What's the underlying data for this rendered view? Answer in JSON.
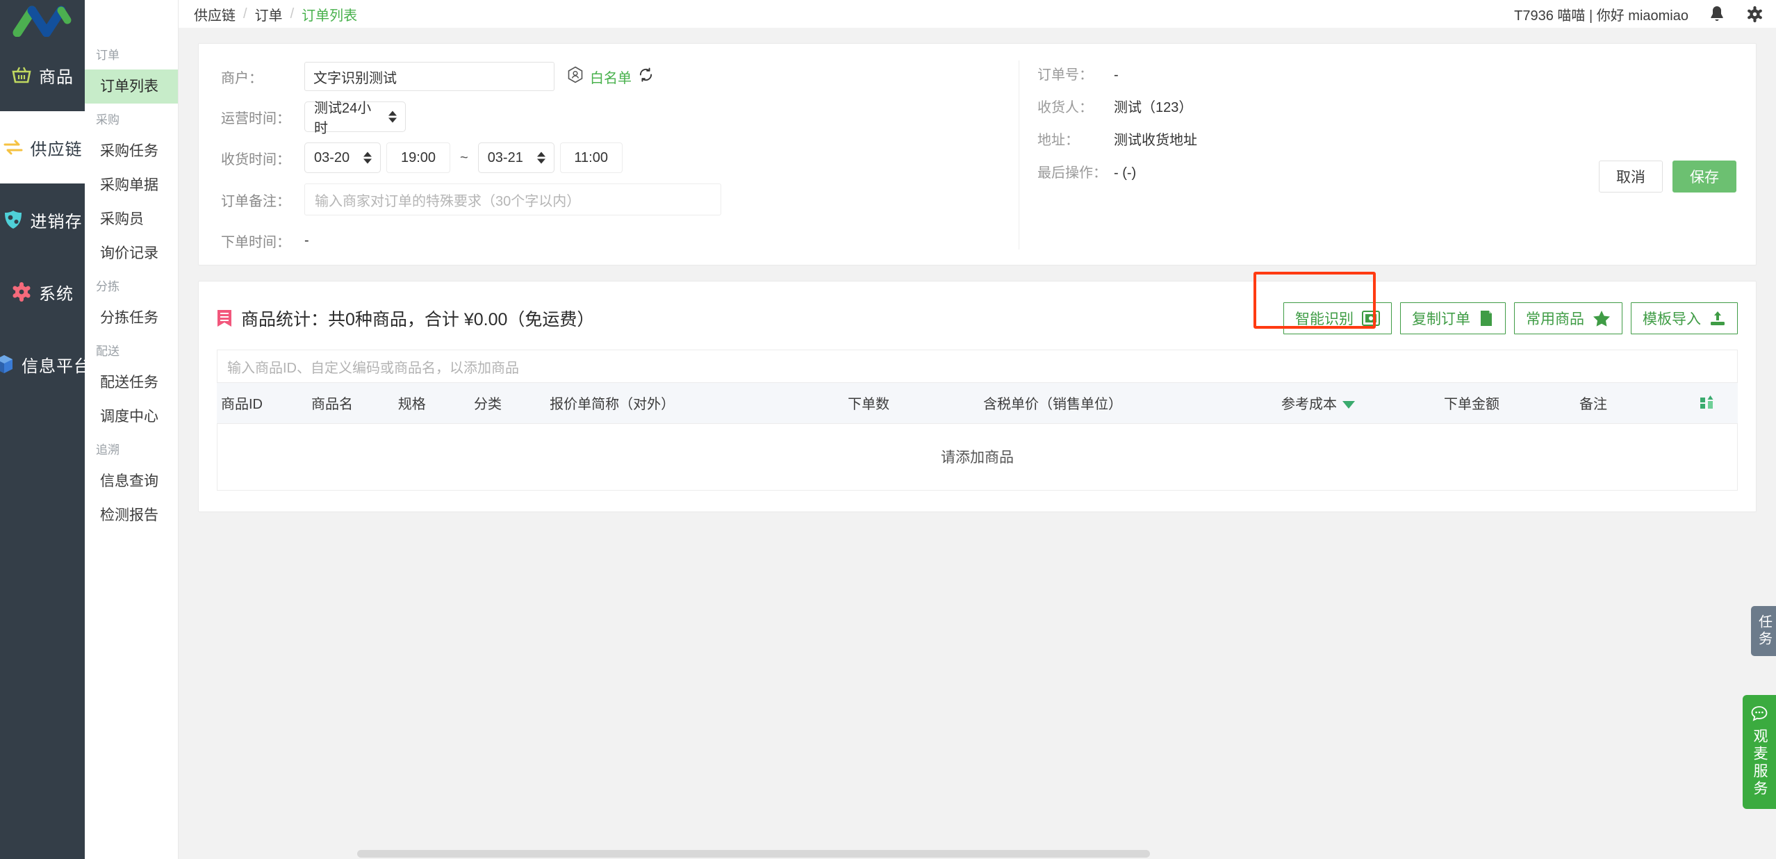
{
  "rail": {
    "logo_name": "app-logo",
    "items": [
      {
        "label": "商品",
        "icon": "basket-icon",
        "active": false
      },
      {
        "label": "供应链",
        "icon": "exchange-arrows-icon",
        "active": true
      },
      {
        "label": "进销存",
        "icon": "shield-inventory-icon",
        "active": false
      },
      {
        "label": "系统",
        "icon": "gear-icon",
        "active": false
      },
      {
        "label": "信息平台",
        "icon": "cube-icon",
        "active": false
      }
    ]
  },
  "submenu": {
    "groups": [
      {
        "title": "订单",
        "items": [
          {
            "label": "订单列表",
            "active": true
          }
        ]
      },
      {
        "title": "采购",
        "items": [
          {
            "label": "采购任务",
            "active": false
          },
          {
            "label": "采购单据",
            "active": false
          },
          {
            "label": "采购员",
            "active": false
          },
          {
            "label": "询价记录",
            "active": false
          }
        ]
      },
      {
        "title": "分拣",
        "items": [
          {
            "label": "分拣任务",
            "active": false
          }
        ]
      },
      {
        "title": "配送",
        "items": [
          {
            "label": "配送任务",
            "active": false
          },
          {
            "label": "调度中心",
            "active": false
          }
        ]
      },
      {
        "title": "追溯",
        "items": [
          {
            "label": "信息查询",
            "active": false
          },
          {
            "label": "检测报告",
            "active": false
          }
        ]
      }
    ]
  },
  "topbar": {
    "breadcrumb": [
      "供应链",
      "订单",
      "订单列表"
    ],
    "separator": "/",
    "user_text": "T7936 喵喵 | 你好 miaomiao",
    "bell_icon": "bell-icon",
    "gear_icon": "gear-icon"
  },
  "form": {
    "merchant_label": "商户：",
    "merchant_value": "文字识别测试",
    "whitelist_label": "白名单",
    "whitelist_icon": "user-hexagon-icon",
    "refresh_icon": "refresh-icon",
    "operating_label": "运营时间：",
    "operating_value": "测试24小时",
    "receive_label": "收货时间：",
    "receive_date_start": "03-20",
    "receive_time_start": "19:00",
    "range_sep": "~",
    "receive_date_end": "03-21",
    "receive_time_end": "11:00",
    "notes_label": "订单备注：",
    "notes_placeholder": "输入商家对订单的特殊要求（30个字以内）",
    "notes_value": "",
    "order_time_label": "下单时间：",
    "order_time_value": "-"
  },
  "info": {
    "rows": [
      {
        "label": "订单号：",
        "value": "-"
      },
      {
        "label": "收货人：",
        "value": "测试（123）"
      },
      {
        "label": "地址：",
        "value": "测试收货地址"
      },
      {
        "label": "最后操作：",
        "value": "- (-)"
      }
    ],
    "cancel_label": "取消",
    "save_label": "保存"
  },
  "products": {
    "summary": "商品统计：共0种商品，合计 ¥0.00（免运费）",
    "summary_icon": "ribbon-icon",
    "actions": [
      {
        "label": "智能识别",
        "icon": "ocr-scan-icon",
        "highlighted": true
      },
      {
        "label": "复制订单",
        "icon": "copy-icon",
        "highlighted": false
      },
      {
        "label": "常用商品",
        "icon": "star-icon",
        "highlighted": false
      },
      {
        "label": "模板导入",
        "icon": "upload-icon",
        "highlighted": false
      }
    ],
    "add_placeholder": "输入商品ID、自定义编码或商品名，以添加商品",
    "columns": [
      {
        "label": "商品ID",
        "align": "left",
        "sort": false,
        "icon": ""
      },
      {
        "label": "商品名",
        "align": "left",
        "sort": false,
        "icon": ""
      },
      {
        "label": "规格",
        "align": "left",
        "sort": false,
        "icon": ""
      },
      {
        "label": "分类",
        "align": "left",
        "sort": false,
        "icon": ""
      },
      {
        "label": "报价单简称（对外）",
        "align": "left",
        "sort": false,
        "icon": ""
      },
      {
        "label": "下单数",
        "align": "left",
        "sort": false,
        "icon": ""
      },
      {
        "label": "含税单价（销售单位）",
        "align": "left",
        "sort": false,
        "icon": ""
      },
      {
        "label": "参考成本",
        "align": "left",
        "sort": true,
        "icon": ""
      },
      {
        "label": "下单金额",
        "align": "left",
        "sort": false,
        "icon": ""
      },
      {
        "label": "备注",
        "align": "left",
        "sort": false,
        "icon": ""
      },
      {
        "label": "",
        "align": "center",
        "sort": false,
        "icon": "column-settings-icon"
      }
    ],
    "rows": [],
    "empty_text": "请添加商品"
  },
  "side_tabs": {
    "task_label": "任务",
    "service_label": "观麦服务",
    "service_icon": "chat-bubble-icon"
  },
  "colors": {
    "brand_green": "#48b14c",
    "save_green": "#6cc071",
    "rail_dark": "#343e48",
    "active_submenu": "#c7ecc9",
    "highlight_red": "#ff3b12",
    "task_tab": "#6c7b8b"
  }
}
